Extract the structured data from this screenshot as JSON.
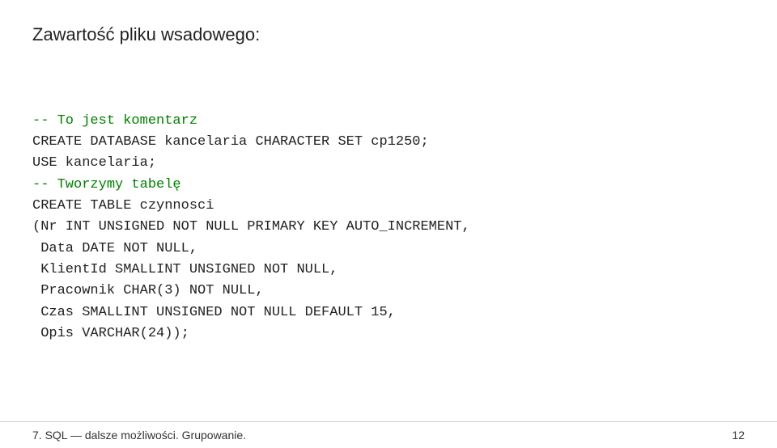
{
  "page": {
    "title": "Zawartość pliku wsadowego:",
    "code_lines": [
      {
        "type": "blank",
        "text": ""
      },
      {
        "type": "comment",
        "text": "-- To jest komentarz"
      },
      {
        "type": "code",
        "text": "CREATE DATABASE kancelaria CHARACTER SET cp1250;"
      },
      {
        "type": "code",
        "text": "USE kancelaria;"
      },
      {
        "type": "comment",
        "text": "-- Tworzymy tabelę"
      },
      {
        "type": "code",
        "text": "CREATE TABLE czynnosci"
      },
      {
        "type": "code",
        "text": "(Nr INT UNSIGNED NOT NULL PRIMARY KEY AUTO_INCREMENT,"
      },
      {
        "type": "code",
        "text": " Data DATE NOT NULL,"
      },
      {
        "type": "code",
        "text": " KlientId SMALLINT UNSIGNED NOT NULL,"
      },
      {
        "type": "code",
        "text": " Pracownik CHAR(3) NOT NULL,"
      },
      {
        "type": "code",
        "text": " Czas SMALLINT UNSIGNED NOT NULL DEFAULT 15,"
      },
      {
        "type": "code",
        "text": " Opis VARCHAR(24));"
      }
    ],
    "footer": {
      "left_text": "7. SQL — dalsze możliwości. Grupowanie.",
      "page_number": "12"
    }
  }
}
